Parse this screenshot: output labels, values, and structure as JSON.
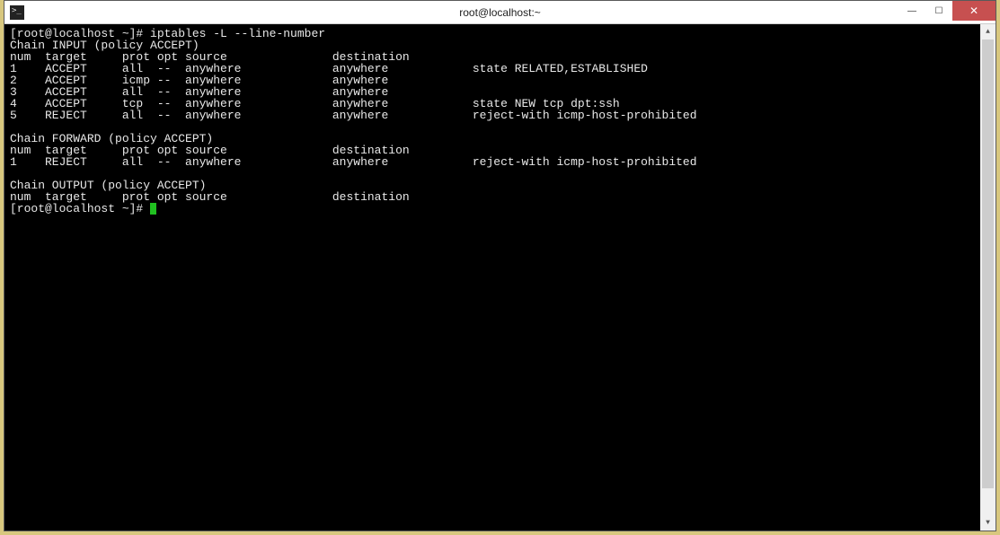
{
  "window": {
    "title": "root@localhost:~"
  },
  "prompt1": "[root@localhost ~]# ",
  "command1": "iptables -L --line-number",
  "chains": [
    {
      "header": "Chain INPUT (policy ACCEPT)",
      "cols": "num  target     prot opt source               destination",
      "rules": [
        "1    ACCEPT     all  --  anywhere             anywhere            state RELATED,ESTABLISHED",
        "2    ACCEPT     icmp --  anywhere             anywhere",
        "3    ACCEPT     all  --  anywhere             anywhere",
        "4    ACCEPT     tcp  --  anywhere             anywhere            state NEW tcp dpt:ssh",
        "5    REJECT     all  --  anywhere             anywhere            reject-with icmp-host-prohibited"
      ]
    },
    {
      "header": "Chain FORWARD (policy ACCEPT)",
      "cols": "num  target     prot opt source               destination",
      "rules": [
        "1    REJECT     all  --  anywhere             anywhere            reject-with icmp-host-prohibited"
      ]
    },
    {
      "header": "Chain OUTPUT (policy ACCEPT)",
      "cols": "num  target     prot opt source               destination",
      "rules": []
    }
  ],
  "prompt2": "[root@localhost ~]# "
}
